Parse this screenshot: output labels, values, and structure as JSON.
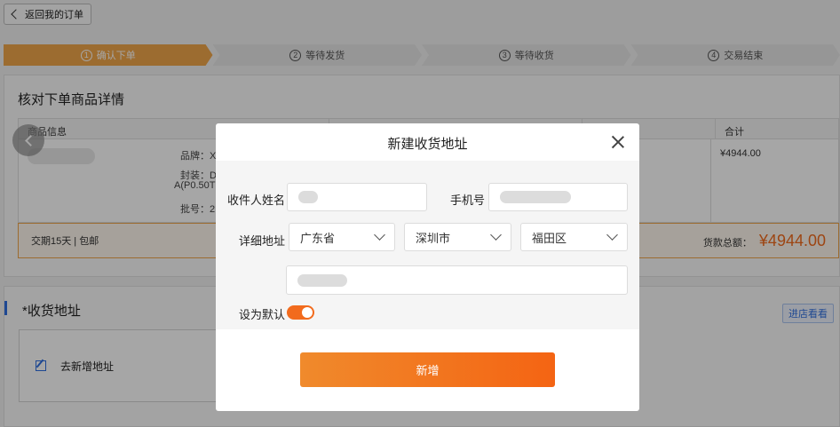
{
  "header": {
    "back_label": "返回我的订单"
  },
  "steps": [
    {
      "num": "1",
      "label": "确认下单",
      "active": true
    },
    {
      "num": "2",
      "label": "等待发货",
      "active": false
    },
    {
      "num": "3",
      "label": "等待收货",
      "active": false
    },
    {
      "num": "4",
      "label": "交易结束",
      "active": false
    }
  ],
  "order": {
    "title": "核对下单商品详情",
    "columns": {
      "info": "商品信息",
      "total": "合计"
    },
    "specs": {
      "brand": "品牌：X",
      "package": "封装：D",
      "model": "A(P0.50T",
      "batch": "批号：2"
    },
    "row_total": "¥4944.00",
    "terms": "交期15天 | 包邮",
    "sum_label": "货款总额：",
    "sum_amount": "¥4944.00"
  },
  "address": {
    "title": "*收货地址",
    "store_button": "进店看看",
    "new_address": "去新增地址"
  },
  "modal": {
    "title": "新建收货地址",
    "name_label": "收件人姓名",
    "phone_label": "手机号",
    "address_label": "详细地址",
    "province": "广东省",
    "city": "深圳市",
    "district": "福田区",
    "default_label": "设为默认",
    "default_on": true,
    "submit_label": "新增"
  },
  "colors": {
    "accent": "#f26b1d",
    "step_active": "#f0a64a",
    "link": "#2f6fe0"
  }
}
